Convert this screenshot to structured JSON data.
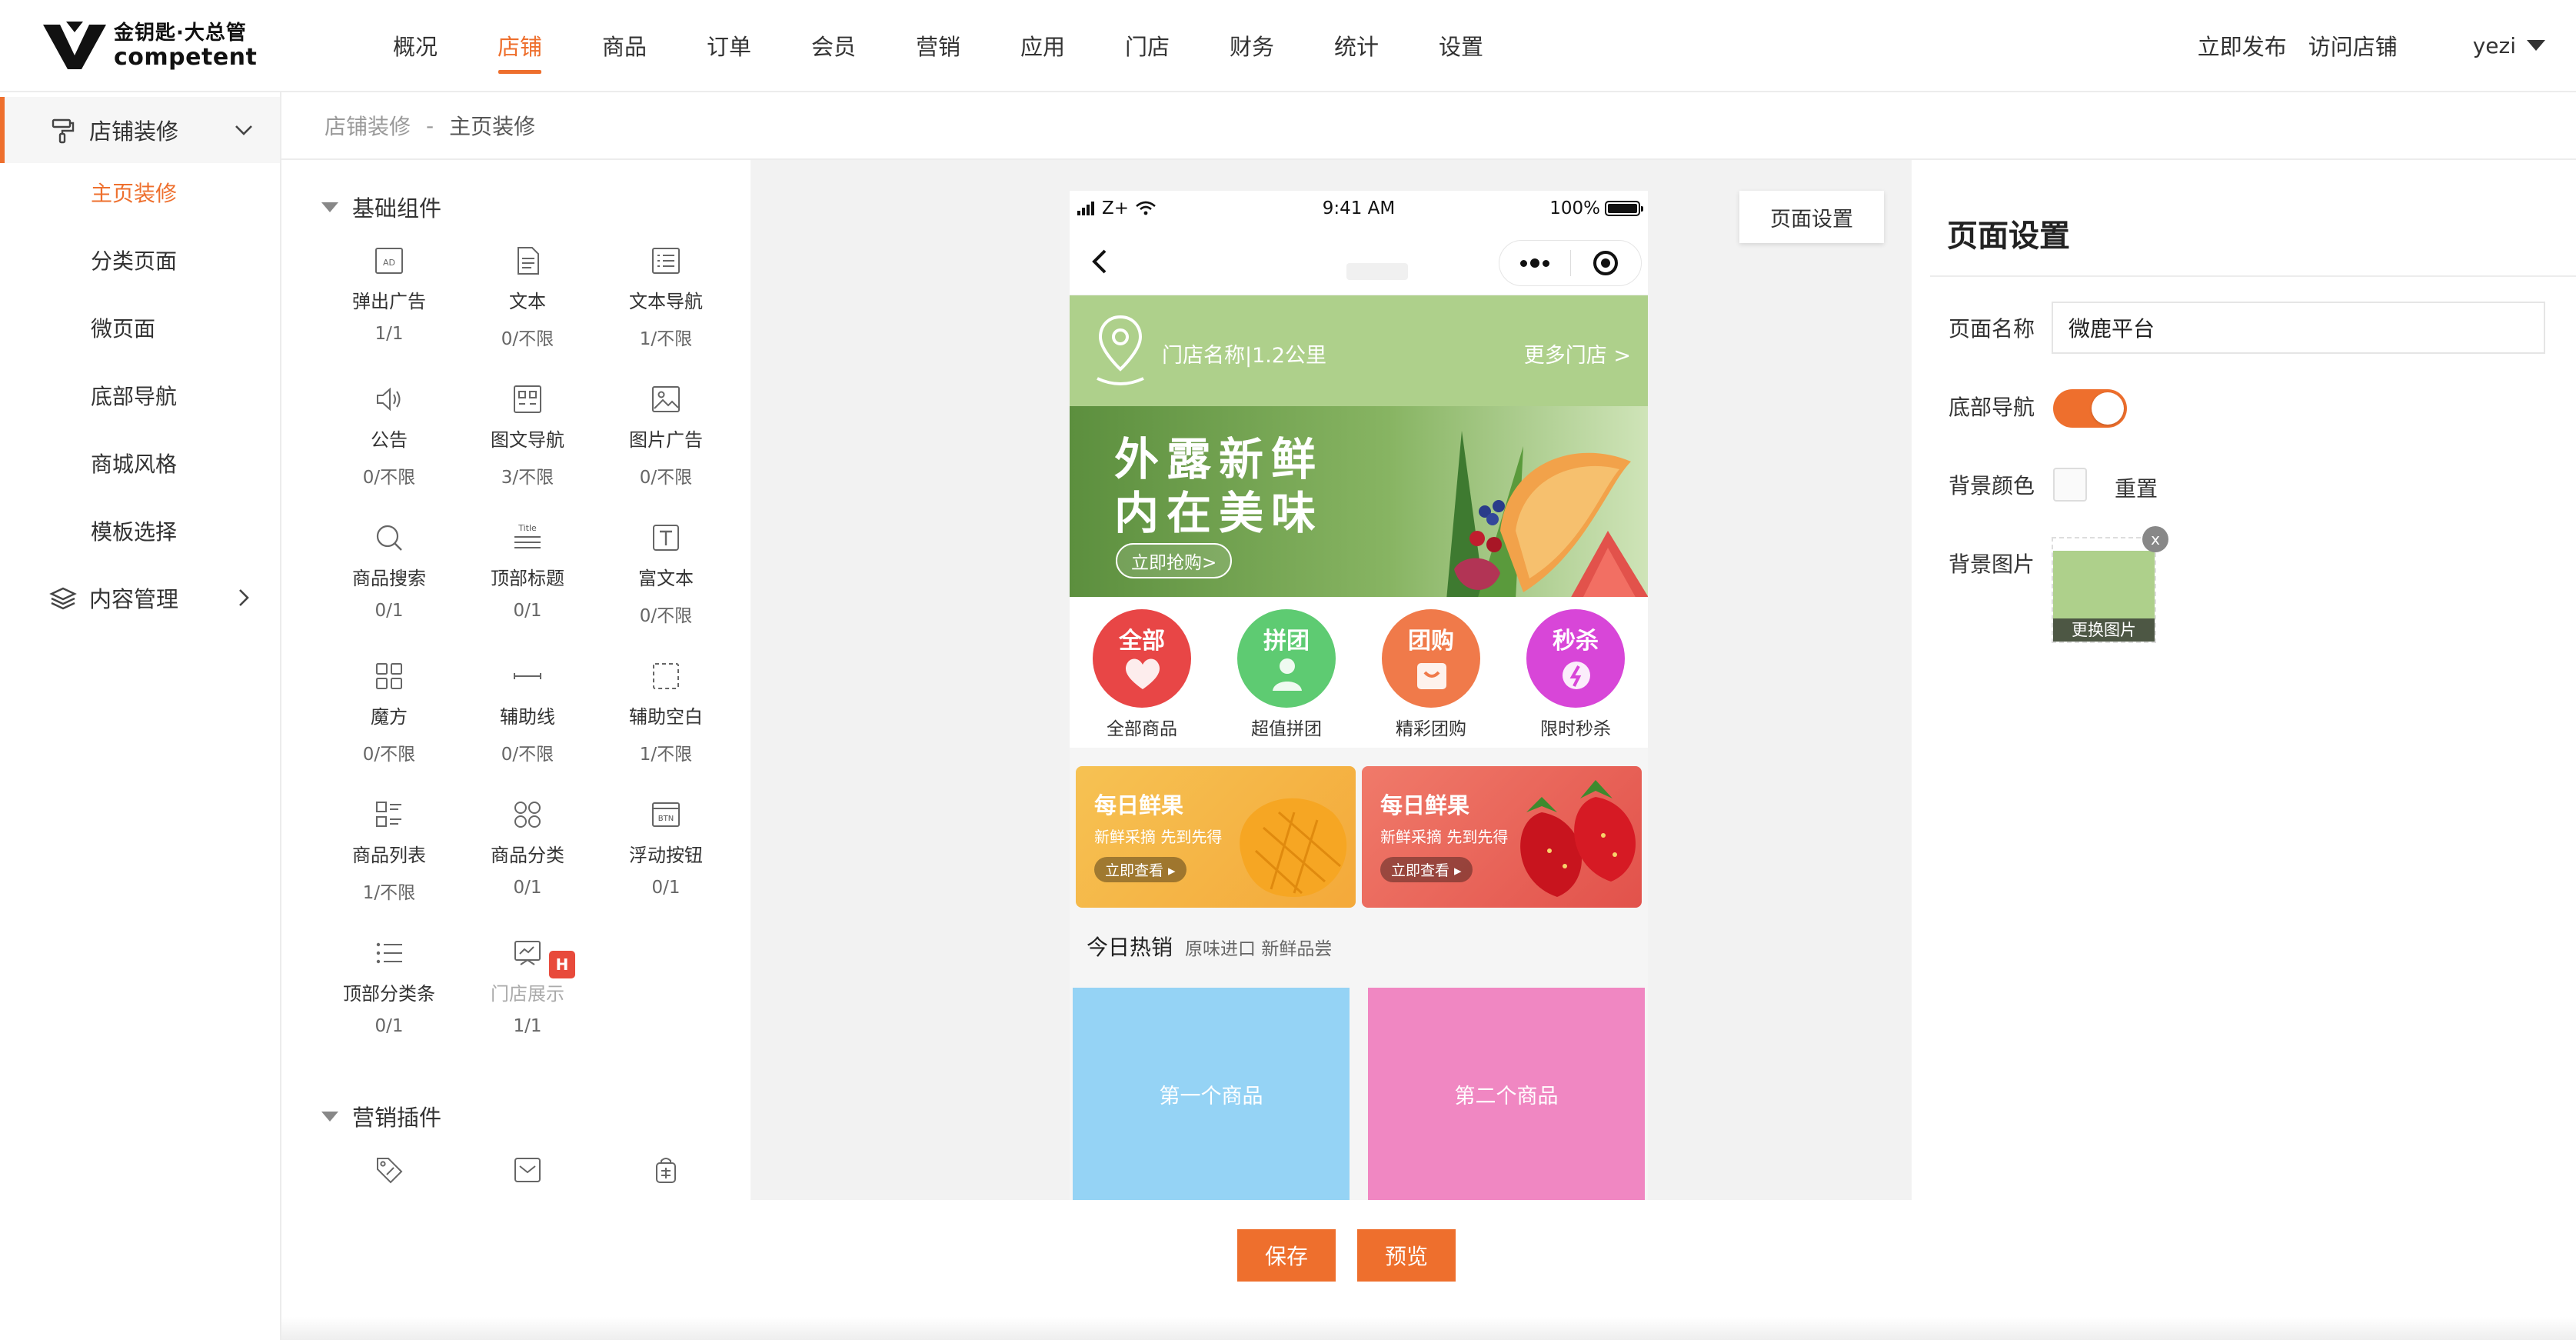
{
  "logo": {
    "cn": "金钥匙·大总管",
    "en": "competent"
  },
  "topnav": {
    "items": [
      "概况",
      "店铺",
      "商品",
      "订单",
      "会员",
      "营销",
      "应用",
      "门店",
      "财务",
      "统计",
      "设置"
    ],
    "active_index": 1,
    "publish": "立即发布",
    "visit": "访问店铺",
    "user": "yezi"
  },
  "sidebar": {
    "group1": "店铺装修",
    "items": [
      "主页装修",
      "分类页面",
      "微页面",
      "底部导航",
      "商城风格",
      "模板选择"
    ],
    "active_index": 0,
    "group2": "内容管理"
  },
  "breadcrumb": {
    "parent": "店铺装修",
    "sep": "-",
    "current": "主页装修"
  },
  "palette": {
    "section1": "基础组件",
    "components": [
      {
        "name": "弹出广告",
        "count": "1/1",
        "icon": "ad-icon"
      },
      {
        "name": "文本",
        "count": "0/不限",
        "icon": "document-icon"
      },
      {
        "name": "文本导航",
        "count": "1/不限",
        "icon": "list-box-icon"
      },
      {
        "name": "公告",
        "count": "0/不限",
        "icon": "speaker-icon"
      },
      {
        "name": "图文导航",
        "count": "3/不限",
        "icon": "image-text-nav-icon"
      },
      {
        "name": "图片广告",
        "count": "0/不限",
        "icon": "image-icon"
      },
      {
        "name": "商品搜索",
        "count": "0/1",
        "icon": "search-icon"
      },
      {
        "name": "顶部标题",
        "count": "0/1",
        "icon": "title-icon"
      },
      {
        "name": "富文本",
        "count": "0/不限",
        "icon": "rich-text-icon"
      },
      {
        "name": "魔方",
        "count": "0/不限",
        "icon": "cube-grid-icon"
      },
      {
        "name": "辅助线",
        "count": "0/不限",
        "icon": "divider-line-icon"
      },
      {
        "name": "辅助空白",
        "count": "1/不限",
        "icon": "blank-space-icon"
      },
      {
        "name": "商品列表",
        "count": "1/不限",
        "icon": "product-list-icon"
      },
      {
        "name": "商品分类",
        "count": "0/1",
        "icon": "category-icon"
      },
      {
        "name": "浮动按钮",
        "count": "0/1",
        "icon": "btn-icon"
      },
      {
        "name": "顶部分类条",
        "count": "0/1",
        "icon": "bullet-list-icon"
      },
      {
        "name": "门店展示",
        "count": "1/1",
        "icon": "store-display-icon"
      }
    ],
    "title_icon_text": "Title",
    "btn_icon_text": "BTN",
    "badge": "H",
    "section2": "营销插件",
    "marketing_icons": [
      "coupon-tag-icon",
      "mail-icon",
      "gift-bag-icon"
    ]
  },
  "preview": {
    "status": {
      "carrier": "Z+",
      "time": "9:41 AM",
      "battery": "100%"
    },
    "store_name": "门店名称|1.2公里",
    "more_stores": "更多门店 >",
    "banner": {
      "line1": "外露新鲜",
      "line2": "内在美味",
      "button": "立即抢购>"
    },
    "categories": [
      {
        "circle": "全部",
        "label": "全部商品",
        "color": "#e84646"
      },
      {
        "circle": "拼团",
        "label": "超值拼团",
        "color": "#5ecb72"
      },
      {
        "circle": "团购",
        "label": "精彩团购",
        "color": "#f07a4a"
      },
      {
        "circle": "秒杀",
        "label": "限时秒杀",
        "color": "#d846d8"
      }
    ],
    "promos": [
      {
        "title": "每日鲜果",
        "sub": "新鲜采摘 先到先得",
        "btn": "立即查看 ▸"
      },
      {
        "title": "每日鲜果",
        "sub": "新鲜采摘 先到先得",
        "btn": "立即查看 ▸"
      }
    ],
    "hot_title": "今日热销",
    "hot_sub": "原味进口 新鲜品尝",
    "products": [
      "第一个商品",
      "第二个商品"
    ]
  },
  "page_settings_btn": "页面设置",
  "settings": {
    "title": "页面设置",
    "name_label": "页面名称",
    "name_value": "微鹿平台",
    "nav_label": "底部导航",
    "bg_color_label": "背景颜色",
    "reset": "重置",
    "bg_image_label": "背景图片",
    "change_image": "更换图片",
    "remove": "x"
  },
  "footer": {
    "save": "保存",
    "preview": "预览"
  },
  "colors": {
    "accent": "#ee6f2d",
    "store_green": "#aed08b",
    "product_blue": "#95d3f5",
    "product_pink": "#f087c2"
  }
}
